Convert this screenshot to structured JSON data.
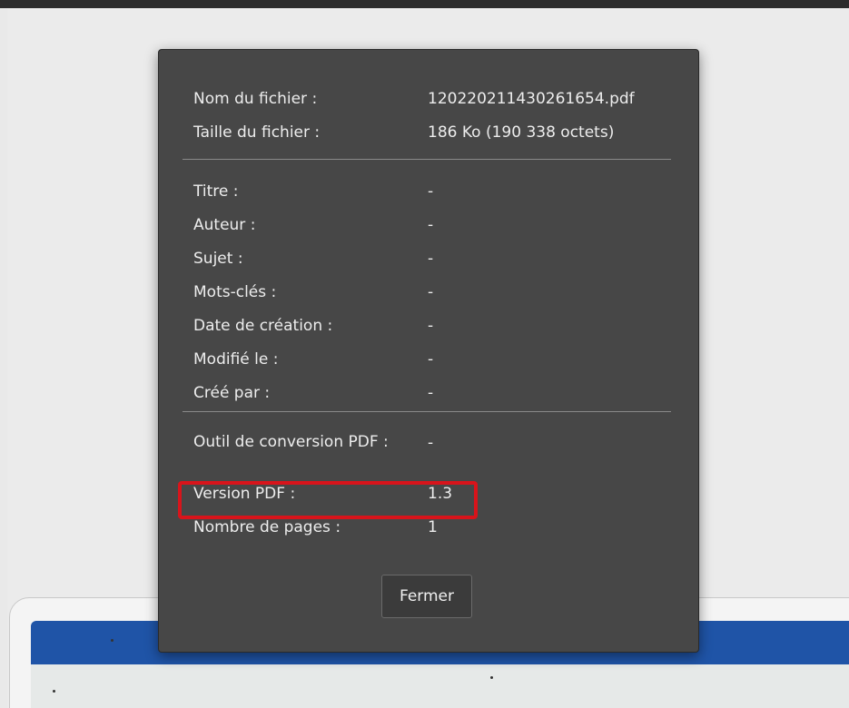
{
  "dialog": {
    "file_info": [
      {
        "label": "Nom du fichier :",
        "value": "120220211430261654.pdf"
      },
      {
        "label": "Taille du fichier :",
        "value": "186 Ko (190 338 octets)"
      }
    ],
    "document_info": [
      {
        "label": "Titre :",
        "value": "-"
      },
      {
        "label": "Auteur :",
        "value": "-"
      },
      {
        "label": "Sujet :",
        "value": "-"
      },
      {
        "label": "Mots-clés :",
        "value": "-"
      },
      {
        "label": "Date de création :",
        "value": "-"
      },
      {
        "label": "Modifié le :",
        "value": "-"
      },
      {
        "label": "Créé par :",
        "value": "-"
      }
    ],
    "pdf_info": [
      {
        "label": "Outil de conversion PDF :",
        "value": "-"
      },
      {
        "label": "Version PDF :",
        "value": "1.3"
      },
      {
        "label": "Nombre de pages :",
        "value": "1"
      }
    ],
    "close_label": "Fermer"
  },
  "colors": {
    "dialog_bg": "#474747",
    "highlight": "#d8141b",
    "doc_blue": "#1f54a7"
  }
}
